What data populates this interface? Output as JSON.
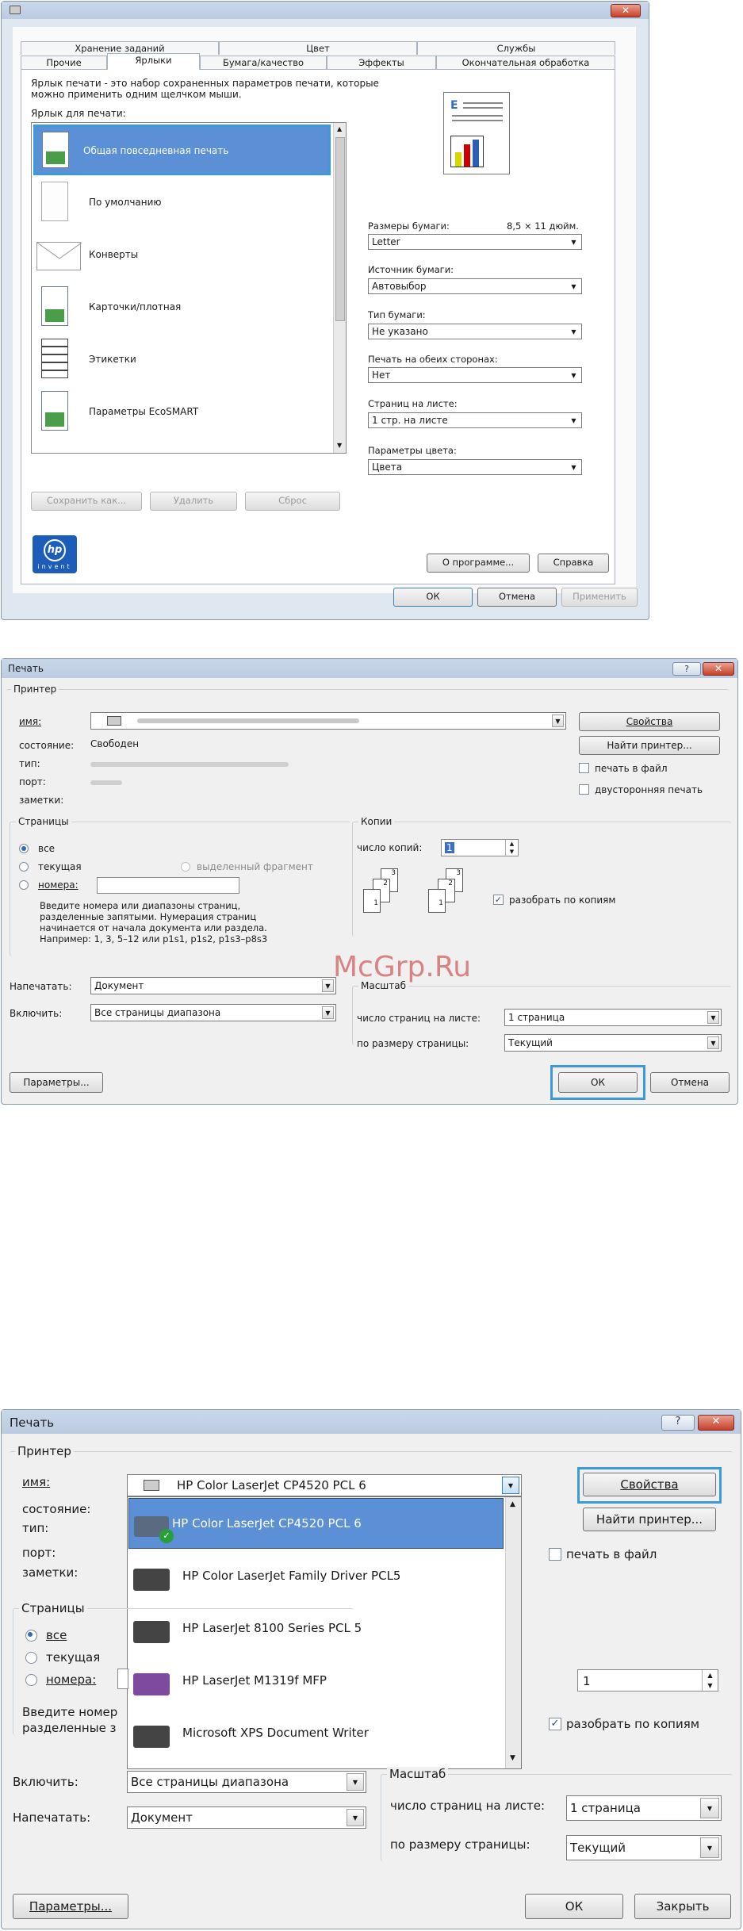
{
  "d1": {
    "tabs_row1": [
      "Хранение заданий",
      "Цвет",
      "Службы"
    ],
    "tabs_row2": [
      "Прочие",
      "Ярлыки",
      "Бумага/качество",
      "Эффекты",
      "Окончательная обработка"
    ],
    "desc1": "Ярлык печати - это набор сохраненных параметров печати, которые",
    "desc2": "можно применить одним щелчком мыши.",
    "list_label": "Ярлык для печати:",
    "items": [
      "Общая повседневная печать",
      "По умолчанию",
      "Конверты",
      "Карточки/плотная",
      "Этикетки",
      "Параметры EcoSMART"
    ],
    "paper_size_label": "Размеры бумаги:",
    "paper_size_dim": "8,5 × 11 дюйм.",
    "paper_size": "Letter",
    "source_label": "Источник бумаги:",
    "source": "Автовыбор",
    "type_label": "Тип бумаги:",
    "type": "Не указано",
    "duplex_label": "Печать на обеих сторонах:",
    "duplex": "Нет",
    "pps_label": "Страниц на листе:",
    "pps": "1 стр. на листе",
    "color_label": "Параметры цвета:",
    "color": "Цвета",
    "save_as": "Сохранить как...",
    "delete": "Удалить",
    "reset": "Сброс",
    "about": "О программе...",
    "help": "Справка",
    "ok": "ОК",
    "cancel": "Отмена",
    "apply": "Применить",
    "hp_logo": "hp",
    "invent": "invent"
  },
  "d2": {
    "title": "Печать",
    "help": "?",
    "close": "✕",
    "printer_group": "Принтер",
    "name_label": "имя:",
    "status_label": "состояние:",
    "status": "Свободен",
    "type_label": "тип:",
    "port_label": "порт:",
    "notes_label": "заметки:",
    "properties": "Свойства",
    "find": "Найти принтер...",
    "print_to_file": "печать в файл",
    "duplex": "двусторонняя печать",
    "pages_group": "Страницы",
    "all": "все",
    "current": "текущая",
    "selection": "выделенный фрагмент",
    "pages": "номера:",
    "hint1": "Введите номера или диапазоны страниц,",
    "hint2": "разделенные запятыми. Нумерация страниц",
    "hint3": "начинается от начала документа или раздела.",
    "hint4": "Например: 1, 3, 5–12 или p1s1, p1s2, p1s3–p8s3",
    "copies_group": "Копии",
    "copies_label": "число копий:",
    "copies": "1",
    "collate": "разобрать по копиям",
    "print_what_label": "Напечатать:",
    "print_what": "Документ",
    "include_label": "Включить:",
    "include": "Все страницы диапазона",
    "zoom_group": "Масштаб",
    "pps_label": "число страниц на листе:",
    "pps": "1 страница",
    "scale_label": "по размеру страницы:",
    "scale": "Текущий",
    "options": "Параметры...",
    "ok": "ОК",
    "cancel": "Отмена",
    "watermark": "McGrp.Ru"
  },
  "d3": {
    "title": "Печать",
    "help": "?",
    "close": "✕",
    "printer_group": "Принтер",
    "name_label": "имя:",
    "status_label": "состояние:",
    "type_label": "тип:",
    "port_label": "порт:",
    "notes_label": "заметки:",
    "selected": "HP Color LaserJet CP4520 PCL 6",
    "printers": [
      "HP Color LaserJet CP4520 PCL 6",
      "HP Color LaserJet Family Driver PCL5",
      "HP LaserJet 8100 Series PCL 5",
      "HP LaserJet M1319f MFP",
      "Microsoft XPS Document Writer"
    ],
    "properties": "Свойства",
    "find": "Найти принтер...",
    "print_to_file": "печать в файл",
    "pages_group": "Страницы",
    "all": "все",
    "current": "текущая",
    "pages": "номера:",
    "hint1": "Введите номер",
    "hint2": "разделенные з",
    "copies": "1",
    "collate": "разобрать по копиям",
    "include_label": "Включить:",
    "include": "Все страницы диапазона",
    "print_what_label": "Напечатать:",
    "print_what": "Документ",
    "zoom_group": "Масштаб",
    "pps_label": "число страниц на листе:",
    "pps": "1 страница",
    "scale_label": "по размеру страницы:",
    "scale": "Текущий",
    "options": "Параметры...",
    "ok": "ОК",
    "close_btn": "Закрыть"
  },
  "colors": {
    "accent": "#2f6bbf",
    "highlight": "#5b8fd6",
    "focus": "#3c9ad8"
  }
}
